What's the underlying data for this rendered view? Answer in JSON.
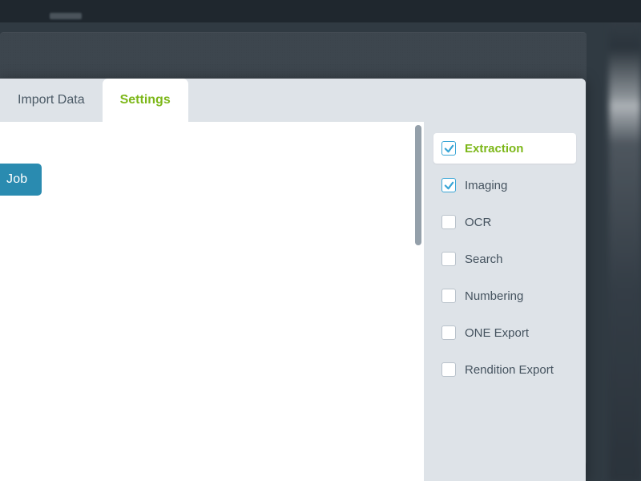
{
  "tabs": {
    "import_data": "Import Data",
    "settings": "Settings",
    "active": "settings"
  },
  "main": {
    "job_button": "Job"
  },
  "side_options": [
    {
      "label": "Extraction",
      "checked": true,
      "active": true
    },
    {
      "label": "Imaging",
      "checked": true,
      "active": false
    },
    {
      "label": "OCR",
      "checked": false,
      "active": false
    },
    {
      "label": "Search",
      "checked": false,
      "active": false
    },
    {
      "label": "Numbering",
      "checked": false,
      "active": false
    },
    {
      "label": "ONE Export",
      "checked": false,
      "active": false
    },
    {
      "label": "Rendition Export",
      "checked": false,
      "active": false
    }
  ],
  "colors": {
    "accent_green": "#7cb718",
    "accent_blue": "#2a8bb0",
    "check_blue": "#3aa6d6",
    "panel_grey": "#dee3e8",
    "dark_bg": "#3d464e"
  }
}
